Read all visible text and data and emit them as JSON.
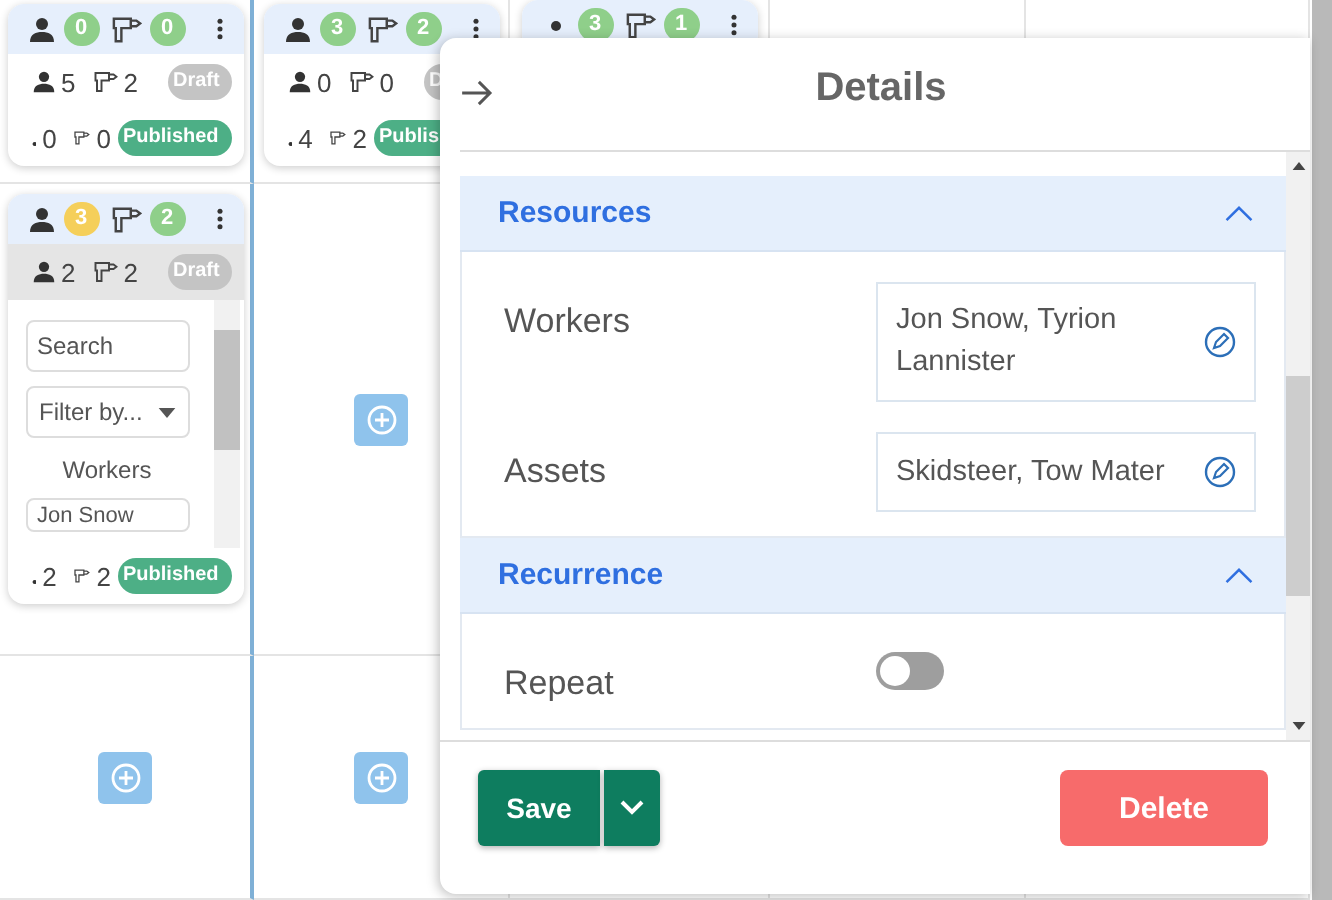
{
  "calendar": {
    "rows": [
      [
        {
          "kind": "card",
          "header": {
            "workers": {
              "value": "0",
              "color": "#8fcf8a"
            },
            "assets": {
              "value": "0",
              "color": "#8fcf8a"
            }
          },
          "rows": [
            {
              "kind": "draft",
              "workers": "5",
              "assets": "2",
              "status": "Draft"
            },
            {
              "kind": "published",
              "workers": "0",
              "assets": "0",
              "status": "Published"
            }
          ]
        },
        {
          "kind": "card",
          "header": {
            "workers": {
              "value": "3",
              "color": "#8fcf8a"
            },
            "assets": {
              "value": "2",
              "color": "#8fcf8a"
            }
          },
          "rows": [
            {
              "kind": "draft",
              "workers": "0",
              "assets": "0",
              "status": "D"
            },
            {
              "kind": "published",
              "workers": "4",
              "assets": "2",
              "status": "Publis"
            }
          ]
        },
        {
          "kind": "card",
          "header": {
            "workers": {
              "value": "3",
              "color": "#8fcf8a"
            },
            "assets": {
              "value": "1",
              "color": "#8fcf8a"
            }
          },
          "dot": true
        },
        {
          "kind": "empty"
        },
        {
          "kind": "empty"
        }
      ],
      [
        {
          "kind": "expanded",
          "header": {
            "workers": {
              "value": "3",
              "color": "#f5cf5a"
            },
            "assets": {
              "value": "2",
              "color": "#8fcf8a"
            }
          },
          "rows": [
            {
              "kind": "draft",
              "workers": "2",
              "assets": "2",
              "status": "Draft"
            },
            {
              "kind": "published",
              "workers": "2",
              "assets": "2",
              "status": "Published"
            }
          ],
          "picker": {
            "search_placeholder": "Search",
            "filter": "Filter by...",
            "heading": "Workers",
            "items": [
              "Jon Snow"
            ]
          }
        },
        {
          "kind": "add"
        },
        {
          "kind": "empty"
        },
        {
          "kind": "empty"
        },
        {
          "kind": "empty"
        }
      ],
      [
        {
          "kind": "add"
        },
        {
          "kind": "add"
        },
        {
          "kind": "empty"
        },
        {
          "kind": "empty"
        },
        {
          "kind": "empty"
        }
      ]
    ]
  },
  "details": {
    "title": "Details",
    "sections": [
      {
        "title": "Resources",
        "expanded": true,
        "fields": [
          {
            "kind": "picker",
            "label": "Workers",
            "value": "Jon Snow, Tyrion Lannister"
          },
          {
            "kind": "picker",
            "label": "Assets",
            "value": "Skidsteer, Tow Mater"
          }
        ]
      },
      {
        "title": "Recurrence",
        "expanded": true,
        "fields": [
          {
            "kind": "toggle",
            "label": "Repeat",
            "on": false
          }
        ]
      }
    ],
    "save_label": "Save",
    "delete_label": "Delete"
  }
}
